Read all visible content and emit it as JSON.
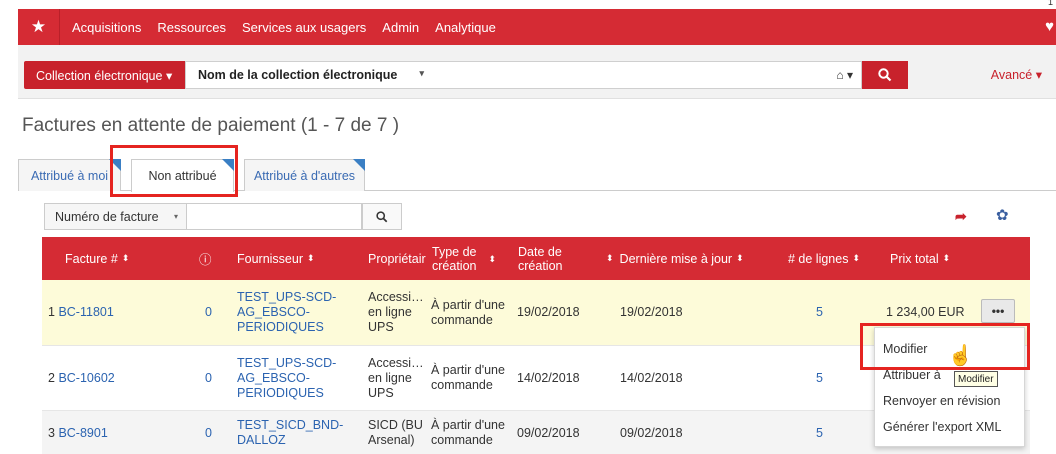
{
  "corner_text": "1",
  "topbar": {
    "menu": [
      "Acquisitions",
      "Ressources",
      "Services aux usagers",
      "Admin",
      "Analytique"
    ]
  },
  "search": {
    "collection_button": "Collection électronique ▾",
    "scope_label": "Nom de la collection électronique",
    "advanced": "Avancé ▾"
  },
  "page": {
    "title": "Factures en attente de paiement (1 - 7 de 7 )"
  },
  "tabs": [
    "Attribué à moi",
    "Non attribué",
    "Attribué à d'autres"
  ],
  "filter": {
    "field": "Numéro de facture"
  },
  "table": {
    "headers": {
      "facture": "Facture #",
      "fournisseur": "Fournisseur",
      "proprietaire": "Propriétair",
      "type_creation": "Type de création",
      "date_creation": "Date de création",
      "derniere_maj": "Dernière mise à jour",
      "nb_lignes": "# de lignes",
      "prix_total": "Prix total"
    },
    "rows": [
      {
        "num": "1",
        "facture": "BC-11801",
        "alert": "0",
        "fournisseur": "TEST_UPS-SCD-AG_EBSCO-PERIODIQUES",
        "proprietaire": "Accessi… en ligne UPS",
        "type": "À partir d'une commande",
        "date_creation": "19/02/2018",
        "derniere_maj": "19/02/2018",
        "lignes": "5",
        "prix": "1 234,00 EUR"
      },
      {
        "num": "2",
        "facture": "BC-10602",
        "alert": "0",
        "fournisseur": "TEST_UPS-SCD-AG_EBSCO-PERIODIQUES",
        "proprietaire": "Accessi… en ligne UPS",
        "type": "À partir d'une commande",
        "date_creation": "14/02/2018",
        "derniere_maj": "14/02/2018",
        "lignes": "5",
        "prix": ""
      },
      {
        "num": "3",
        "facture": "BC-8901",
        "alert": "0",
        "fournisseur": "TEST_SICD_BND-DALLOZ",
        "proprietaire": "SICD (BU Arsenal)",
        "type": "À partir d'une commande",
        "date_creation": "09/02/2018",
        "derniere_maj": "09/02/2018",
        "lignes": "5",
        "prix": ""
      }
    ]
  },
  "row_menu": {
    "more": "•••",
    "items": [
      "Modifier",
      "Attribuer à",
      "Renvoyer en révision",
      "Générer l'export XML"
    ],
    "tooltip": "Modifier"
  },
  "colors": {
    "brand_red": "#d52b34",
    "link_blue": "#2b63b0",
    "highlight_row": "#fdfbd9",
    "annotation_red": "#e52420"
  }
}
